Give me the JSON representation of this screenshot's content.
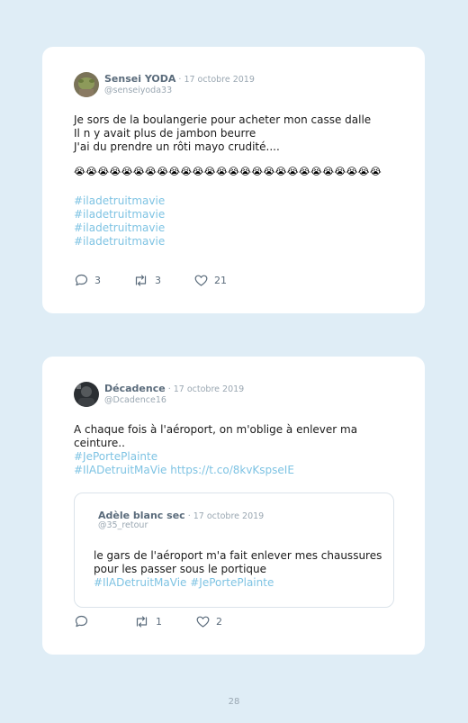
{
  "tweets": [
    {
      "name": "Sensei YODA",
      "date": " · 17 octobre 2019",
      "handle": "@senseiyoda33",
      "lines": [
        "Je sors de la boulangerie pour acheter mon casse dalle",
        "Il n y avait plus de jambon beurre",
        "J'ai du prendre un rôti mayo crudité...."
      ],
      "emojis": "😭😭😭😭😭😭😭😭😭😭😭😭😭😭😭😭😭😭😭😭😭😭😭😭😭😭",
      "hashtags": [
        "#iladetruitmavie",
        "#iladetruitmavie",
        "#iladetruitmavie",
        "#iladetruitmavie"
      ],
      "replies": "3",
      "retweets": "3",
      "likes": "21"
    },
    {
      "name": "Décadence",
      "date": " · 17 octobre 2019",
      "handle": "@Dcadence16",
      "lines": [
        "A chaque fois à l'aéroport, on m'oblige à enlever ma",
        "ceinture.."
      ],
      "hashtags": [
        "#JePortePlainte",
        "#IlADetruitMaVie https://t.co/8kvKspseIE"
      ],
      "replies": "",
      "retweets": "1",
      "likes": "2",
      "quote": {
        "name": "Adèle blanc sec",
        "date": " · 17 octobre 2019",
        "handle": "@35_retour",
        "lines": [
          "le gars de l'aéroport m'a fait enlever mes chaussures",
          "pour les passer sous le portique"
        ],
        "hashtags": "#IlADetruitMaVie #JePortePlainte"
      }
    }
  ],
  "page_number": "28",
  "colors": {
    "background": "#dfedf6",
    "link": "#7ec3e3",
    "muted": "#9aa7b2"
  }
}
